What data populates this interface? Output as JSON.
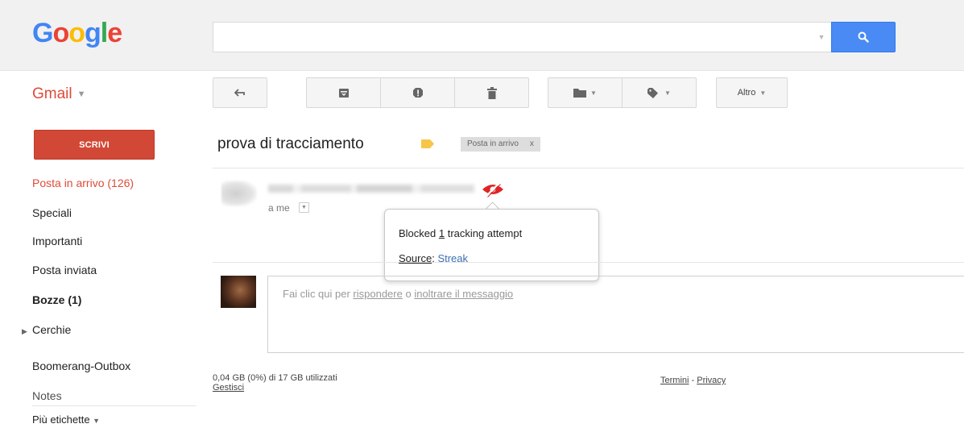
{
  "header": {
    "logo_letters": [
      "G",
      "o",
      "o",
      "g",
      "l",
      "e"
    ],
    "search_value": ""
  },
  "app": {
    "label": "Gmail"
  },
  "toolbar": {
    "altro_label": "Altro"
  },
  "sidebar": {
    "compose_label": "SCRIVI",
    "items": [
      {
        "label": "Posta in arrivo (126)"
      },
      {
        "label": "Speciali"
      },
      {
        "label": "Importanti"
      },
      {
        "label": "Posta inviata"
      },
      {
        "label": "Bozze (1)"
      },
      {
        "label": "Cerchie"
      },
      {
        "label": "Boomerang-Outbox"
      },
      {
        "label": "Notes"
      }
    ],
    "more_labels": "Più etichette"
  },
  "message": {
    "subject": "prova di tracciamento",
    "inbox_chip": "Posta in arrivo",
    "inbox_chip_close": "x",
    "to_me": "a me"
  },
  "tracking_popup": {
    "blocked_prefix": "Blocked ",
    "blocked_count": "1",
    "blocked_suffix": " tracking attempt",
    "source_label": "Source",
    "source_sep": ": ",
    "source_value": "Streak"
  },
  "reply": {
    "prefix": "Fai clic qui per ",
    "reply_link": "rispondere",
    "middle": " o ",
    "forward_link": "inoltrare il messaggio"
  },
  "footer": {
    "storage": "0,04 GB (0%) di 17 GB utilizzati",
    "manage": "Gestisci",
    "terms": "Termini",
    "sep": " - ",
    "privacy": "Privacy"
  },
  "colors": {
    "gmail_red": "#dd4b39",
    "compose_red": "#d14836",
    "search_blue": "#4a8af4",
    "label_yellow": "#f6c648",
    "tracking_red": "#e02424",
    "link_blue": "#3b6fb0"
  }
}
